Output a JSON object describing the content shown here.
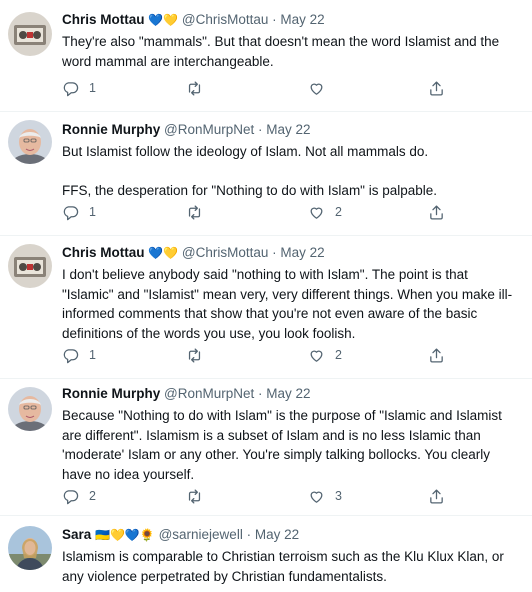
{
  "tweets": [
    {
      "name": "Chris Mottau",
      "emojis": "💙💛",
      "handle": "@ChrisMottau",
      "date": "· May 22",
      "text": "They're also \"mammals\". But that doesn't mean the word Islamist and the word mammal are interchangeable.",
      "replies": "1",
      "retweets": "",
      "likes": "",
      "avatar": "box-icon-avatar"
    },
    {
      "name": "Ronnie Murphy",
      "emojis": "",
      "handle": "@RonMurpNet",
      "date": "· May 22",
      "text": "But Islamist follow the ideology of Islam. Not all mammals do.\n\nFFS, the desperation for \"Nothing to do with Islam\" is palpable.",
      "replies": "1",
      "retweets": "",
      "likes": "2",
      "avatar": "man-photo-avatar"
    },
    {
      "name": "Chris Mottau",
      "emojis": "💙💛",
      "handle": "@ChrisMottau",
      "date": "· May 22",
      "text": "I don't believe anybody said \"nothing to with Islam\". The point is that \"Islamic\" and \"Islamist\" mean very, very different things. When you make ill-informed comments that show that you're not even aware of the basic definitions of the words you use, you look foolish.",
      "replies": "1",
      "retweets": "",
      "likes": "2",
      "avatar": "box-icon-avatar"
    },
    {
      "name": "Ronnie Murphy",
      "emojis": "",
      "handle": "@RonMurpNet",
      "date": "· May 22",
      "text": "Because \"Nothing to do with Islam\" is the purpose of \"Islamic and Islamist are different\". Islamism is a subset of Islam and is no less Islamic than 'moderate' Islam or any other. You're simply talking bollocks. You clearly have no idea yourself.",
      "replies": "2",
      "retweets": "",
      "likes": "3",
      "avatar": "man-photo-avatar"
    },
    {
      "name": "Sara",
      "emojis": "🇺🇦💛💙🌻",
      "handle": "@sarniejewell",
      "date": "· May 22",
      "text": "Islamism is comparable to Christian terroism such as the Klu Klux Klan, or any violence perpetrated by Christian fundamentalists.",
      "avatar": "woman-photo-avatar"
    }
  ],
  "colors": {
    "text": "#0f1419",
    "secondary": "#536471",
    "divider": "#eff3f4"
  }
}
